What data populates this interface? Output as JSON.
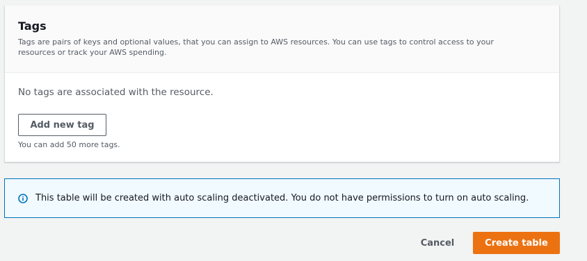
{
  "tags_panel": {
    "title": "Tags",
    "description": "Tags are pairs of keys and optional values, that you can assign to AWS resources. You can use tags to control access to your resources or track your AWS spending.",
    "empty_message": "No tags are associated with the resource.",
    "add_button_label": "Add new tag",
    "limit_message": "You can add 50 more tags."
  },
  "info_alert": {
    "icon": "info-icon",
    "message": "This table will be created with auto scaling deactivated. You do not have permissions to turn on auto scaling."
  },
  "footer": {
    "cancel_label": "Cancel",
    "create_label": "Create table"
  },
  "colors": {
    "primary_button": "#ec7211",
    "info_border": "#0073bb",
    "info_background": "#f1faff"
  }
}
